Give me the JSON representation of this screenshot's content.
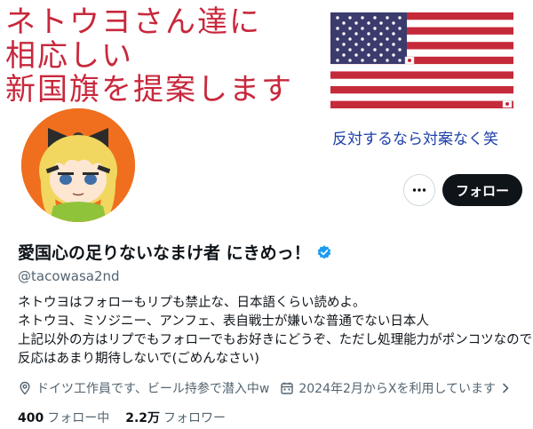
{
  "banner": {
    "line1": "ネトウヨさん達に",
    "line2": "相応しい",
    "line3": "新国旗を提案します",
    "caption": "反対するなら対案なく笑"
  },
  "actions": {
    "more_icon": "more-horizontal-icon",
    "follow_label": "フォロー"
  },
  "profile": {
    "display_name": "愛国心の足りないなまけ者 にきめっ！",
    "handle": "@tacowasa2nd",
    "verified_color": "#1d9bf0",
    "bio": [
      "ネトウヨはフォローもリプも禁止な、日本語くらい読めよ。",
      "ネトウヨ、ミソジニー、アンフェ、表自戦士が嫌いな普通でない日本人",
      "上記以外の方はリプでもフォローでもお好きにどうぞ、ただし処理能力がポンコツなので",
      "反応はあまり期待しないで(ごめんなさい)"
    ],
    "location": "ドイツ工作員です、ビール持参で潜入中w",
    "joined": "2024年2月からXを利用しています"
  },
  "stats": {
    "following_count": "400",
    "following_label": "フォロー中",
    "followers_count": "2.2万",
    "followers_label": "フォロワー"
  },
  "colors": {
    "accent_red": "#c8283c",
    "caption_blue": "#1e3fa8",
    "avatar_bg": "#ef6f1f",
    "button_dark": "#0f1419",
    "muted": "#536471"
  }
}
